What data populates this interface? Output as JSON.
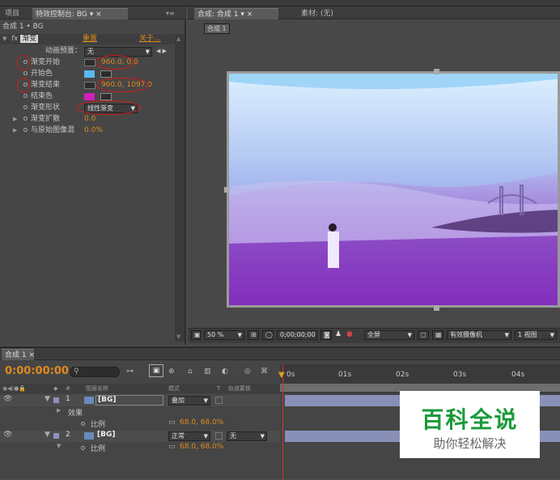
{
  "top_tabs": {
    "project": "项目",
    "effect_controls": "特效控制台: BG",
    "comp": "合成: 合成 1",
    "footage": "素材: (无)"
  },
  "effect_panel": {
    "breadcrumb": "合成 1 • BG",
    "fx_label": "fx",
    "effect_name": "渐变",
    "reset": "重置",
    "about": "关于...",
    "preset_label": "动画预置：",
    "preset_value": "无",
    "props": [
      {
        "name": "渐变开始",
        "value": "960.0, 0.0"
      },
      {
        "name": "开始色",
        "value": ""
      },
      {
        "name": "渐变结束",
        "value": "960.0, 1097.0"
      },
      {
        "name": "结束色",
        "value": ""
      },
      {
        "name": "渐变形状",
        "value": "线性渐变"
      },
      {
        "name": "渐变扩散",
        "value": "0.0"
      },
      {
        "name": "与原始图像混",
        "value": "0.0%"
      }
    ],
    "start_color": "#5ab8f0",
    "end_color": "#d020b8"
  },
  "comp_panel": {
    "comp_tab": "合成 1",
    "zoom": "50 %",
    "timecode": "0;00;00;00",
    "resolution": "全屏",
    "camera": "有效摄像机",
    "view": "1 视图"
  },
  "timeline": {
    "tab": "合成 1",
    "timecode": "0:00:00:00",
    "search_placeholder": "",
    "col_num": "#",
    "col_name": "图层名称",
    "col_mode": "模式",
    "col_t": "T",
    "col_track": "轨道蒙板",
    "ruler": [
      "0s",
      "01s",
      "02s",
      "03s",
      "04s"
    ],
    "layers": [
      {
        "num": "1",
        "name": "[BG]",
        "mode": "叠加",
        "track": ""
      },
      {
        "num": "2",
        "name": "[BG]",
        "mode": "正常",
        "track": "无"
      }
    ],
    "effects_label": "效果",
    "scale_label": "比例",
    "scale_value": "68.0, 68.0%"
  },
  "watermark": {
    "title": "百科全说",
    "subtitle": "助你轻松解决"
  }
}
